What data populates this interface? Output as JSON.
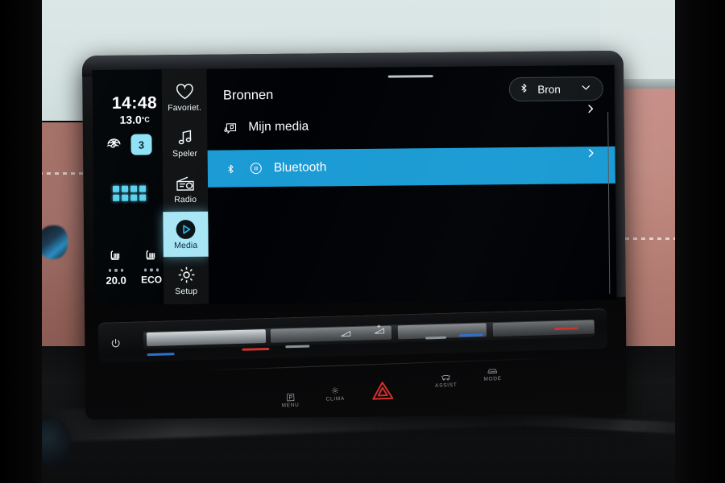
{
  "status": {
    "clock": "14:48",
    "outside_temp": "13.0",
    "temp_unit": "°C",
    "fan_speed": "3",
    "defrost_icon": "windshield-defrost-icon",
    "app_grid_icon": "app-grid-icon"
  },
  "climate": {
    "driver_seat_heat_icon": "seat-heating-icon",
    "driver_temp": "20.0",
    "passenger_seat_heat_icon": "seat-heating-icon",
    "eco_label": "ECO",
    "driver_heat_dots": 3,
    "passenger_heat_dots": 3
  },
  "rail": {
    "items": [
      {
        "label": "Favoriet.",
        "icon": "heart-icon",
        "active": false
      },
      {
        "label": "Speler",
        "icon": "music-note-icon",
        "active": false
      },
      {
        "label": "Radio",
        "icon": "radio-icon",
        "active": false
      },
      {
        "label": "Media",
        "icon": "play-circle-icon",
        "active": true
      },
      {
        "label": "Setup",
        "icon": "gear-icon",
        "active": false
      }
    ]
  },
  "main": {
    "title": "Bronnen",
    "source_button": {
      "label": "Bron",
      "icon": "bluetooth-icon",
      "chevron": "chevron-down-icon"
    },
    "rows": [
      {
        "label": "Mijn media",
        "icon": "my-media-icon",
        "status_icon": "",
        "selected": false,
        "chevron": "›"
      },
      {
        "label": "Bluetooth",
        "icon": "bluetooth-icon",
        "status_icon": "pause-circle-icon",
        "selected": true,
        "chevron": "›"
      }
    ]
  },
  "slider": {
    "power_icon": "power-icon",
    "volume_down_icon": "volume-down-icon",
    "volume_up_icon": "volume-up-icon"
  },
  "hard_buttons": [
    {
      "label": "MENU",
      "icon": "park-menu-icon"
    },
    {
      "label": "CLIMA",
      "icon": "climate-fan-icon"
    },
    {
      "label": "",
      "icon": "hazard-triangle-icon"
    },
    {
      "label": "ASSIST",
      "icon": "assist-icon"
    },
    {
      "label": "MODE",
      "icon": "drive-mode-icon"
    }
  ],
  "colors": {
    "accent_blue": "#1b9bd4",
    "active_cyan": "#a8e6f5",
    "grid_cyan": "#58d2f0",
    "hazard_red": "#d7302a",
    "screen_black": "#000306"
  }
}
